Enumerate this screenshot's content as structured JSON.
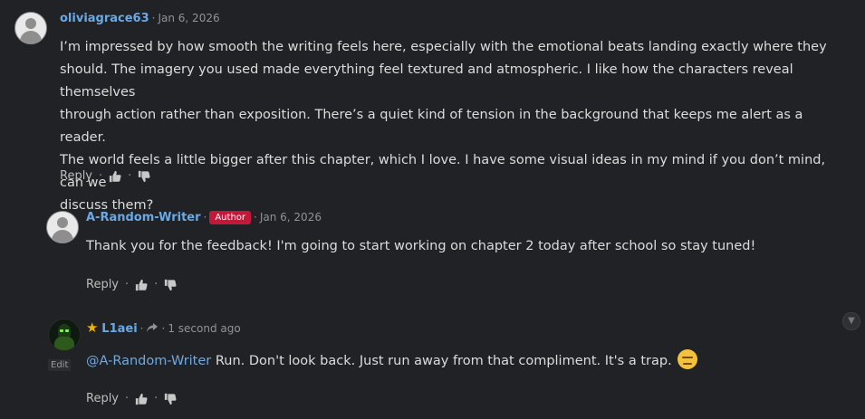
{
  "comments": [
    {
      "username": "oliviagrace63",
      "date": "Jan 6, 2026",
      "text_lines": [
        "I’m impressed by how smooth the writing feels here, especially with the emotional beats landing exactly where they",
        "should. The imagery you used made everything feel textured and atmospheric. I like how the characters reveal themselves",
        "through action rather than exposition. There’s a quiet kind of tension in the background that keeps me alert as a reader.",
        "The world feels a little bigger after this chapter, which I love. I have some visual ideas in my mind if you don’t mind, can we",
        "discuss them?"
      ],
      "reply_label": "Reply"
    },
    {
      "username": "A-Random-Writer",
      "badge": "Author",
      "date": "Jan 6, 2026",
      "text": "Thank you for the feedback! I'm going to start working on chapter 2 today after school so stay tuned!",
      "reply_label": "Reply"
    },
    {
      "username": "L1aei",
      "date": "1 second ago",
      "edit_label": "Edit",
      "mention": "@A-Random-Writer",
      "text": " Run. Don't look back. Just run away from that compliment. It's a trap.",
      "reply_label": "Reply"
    }
  ],
  "icons": {
    "like": "thumbs-up-icon",
    "dislike": "thumbs-down-icon",
    "star": "star-icon",
    "share": "share-arrow-icon",
    "scroll": "chevron-down-icon"
  },
  "colors": {
    "background": "#202225",
    "username": "#69a9e6",
    "badge": "#c4173a"
  }
}
